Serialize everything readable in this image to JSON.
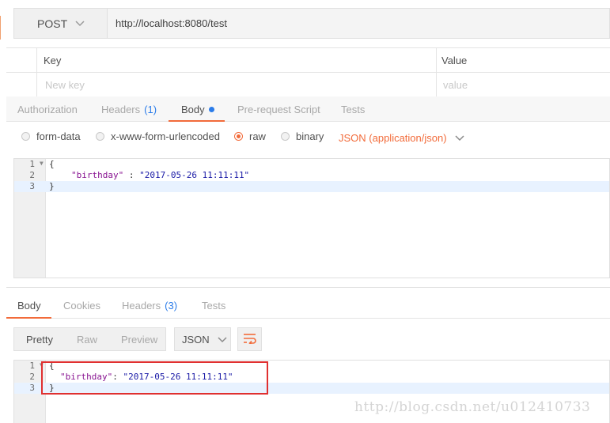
{
  "request": {
    "method": "POST",
    "url": "http://localhost:8080/test"
  },
  "params": {
    "headers": {
      "key": "Key",
      "value": "Value"
    },
    "placeholders": {
      "key": "New key",
      "value": "value"
    }
  },
  "request_tabs": [
    {
      "label": "Authorization"
    },
    {
      "label": "Headers",
      "count": "(1)"
    },
    {
      "label": "Body"
    },
    {
      "label": "Pre-request Script"
    },
    {
      "label": "Tests"
    }
  ],
  "body_types": {
    "form_data": "form-data",
    "urlencoded": "x-www-form-urlencoded",
    "raw": "raw",
    "binary": "binary",
    "content_type": "JSON (application/json)",
    "selected": "raw"
  },
  "request_body": {
    "line_numbers": [
      "1",
      "2",
      "3"
    ],
    "open": "{",
    "key": "\"birthday\"",
    "separator": " : ",
    "value": "\"2017-05-26 11:11:11\"",
    "close": "}"
  },
  "response_tabs": [
    {
      "label": "Body"
    },
    {
      "label": "Cookies"
    },
    {
      "label": "Headers",
      "count": "(3)"
    },
    {
      "label": "Tests"
    }
  ],
  "response_toolbar": {
    "pretty": "Pretty",
    "raw": "Raw",
    "preview": "Preview",
    "format": "JSON"
  },
  "response_body": {
    "line_numbers": [
      "1",
      "2",
      "3"
    ],
    "open": "{",
    "key": "\"birthday\"",
    "separator": ": ",
    "value": "\"2017-05-26 11:11:11\"",
    "close": "}"
  },
  "watermark": "http://blog.csdn.net/u012410733",
  "colors": {
    "accent": "#f26b3a",
    "link": "#2b7ce9",
    "highlight": "#e03030"
  }
}
